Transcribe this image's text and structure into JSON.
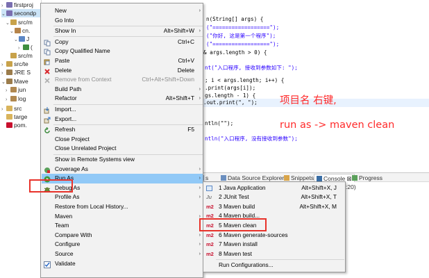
{
  "tree": {
    "items": [
      {
        "label": "firstproj",
        "indent": 0,
        "arrow": "›",
        "icon_color": "#7a6fb0"
      },
      {
        "label": "secondp",
        "indent": 0,
        "arrow": "⌄",
        "icon_color": "#7a6fb0",
        "selected": true
      },
      {
        "label": "src/m",
        "indent": 1,
        "arrow": "⌄",
        "icon_color": "#c8a24a"
      },
      {
        "label": "cn.",
        "indent": 2,
        "arrow": "⌄",
        "icon_color": "#b6844a"
      },
      {
        "label": "J",
        "indent": 3,
        "arrow": "⌄",
        "icon_color": "#5b87c5"
      },
      {
        "label": "(",
        "indent": 4,
        "arrow": "›",
        "icon_color": "#3f8f3f"
      },
      {
        "label": "src/m",
        "indent": 1,
        "arrow": "",
        "icon_color": "#c8a24a"
      },
      {
        "label": "src/te",
        "indent": 0,
        "arrow": "›",
        "icon_color": "#c8a24a"
      },
      {
        "label": "JRE S",
        "indent": 0,
        "arrow": "›",
        "icon_color": "#9b7c4b"
      },
      {
        "label": "Mave",
        "indent": 0,
        "arrow": "⌄",
        "icon_color": "#9b7c4b"
      },
      {
        "label": "jun",
        "indent": 1,
        "arrow": "›",
        "icon_color": "#b08850"
      },
      {
        "label": "log",
        "indent": 1,
        "arrow": "›",
        "icon_color": "#b08850"
      },
      {
        "label": "src",
        "indent": 0,
        "arrow": "›",
        "icon_color": "#d9b45c"
      },
      {
        "label": "targe",
        "indent": 0,
        "arrow": "",
        "icon_color": "#d9b45c"
      },
      {
        "label": "pom.",
        "indent": 0,
        "arrow": "",
        "icon_color": "#c8102e"
      }
    ]
  },
  "editor": {
    "lines": [
      {
        "parts": [
          {
            "t": "n(String[] args) {",
            "c": ""
          }
        ]
      },
      {
        "parts": [
          {
            "t": "(\"==================\");",
            "c": "str"
          }
        ]
      },
      {
        "parts": [
          {
            "t": "(\"你好, 这是第一个程序\");",
            "c": "str"
          }
        ]
      },
      {
        "parts": [
          {
            "t": "(\"==================\");",
            "c": "str"
          }
        ]
      },
      {
        "parts": [
          {
            "t": "",
            "c": ""
          }
        ]
      },
      {
        "parts": [
          {
            "t": "& args.length > 0) {",
            "c": ""
          }
        ]
      },
      {
        "parts": [
          {
            "t": "",
            "c": ""
          }
        ]
      },
      {
        "parts": [
          {
            "t": "nt(\"入口程序, 接收到参数如下: \");",
            "c": "str"
          }
        ]
      },
      {
        "parts": [
          {
            "t": "",
            "c": ""
          }
        ]
      },
      {
        "parts": [
          {
            "t": "; i < args.length; i++) {",
            "c": ""
          }
        ]
      },
      {
        "parts": [
          {
            "t": ".print(args[i]);",
            "c": ""
          }
        ]
      },
      {
        "parts": [
          {
            "t": "gs.length - 1) {",
            "c": ""
          }
        ]
      },
      {
        "parts": [
          {
            "t": ".out.print(\", \");",
            "c": ""
          }
        ]
      },
      {
        "parts": [
          {
            "t": "",
            "c": ""
          }
        ]
      },
      {
        "parts": [
          {
            "t": "ntln(\"\");",
            "c": ""
          }
        ]
      },
      {
        "parts": [
          {
            "t": "ntln(\"入口程序, 没有接收到参数\");",
            "c": "str"
          }
        ]
      }
    ],
    "annotation_1": "项目名 右键,",
    "annotation_2": "run as -> maven clean"
  },
  "bottom_tabs": [
    {
      "label": "s",
      "icon": "tab-icon"
    },
    {
      "label": "Data Source Explorer",
      "icon": "data-source-icon"
    },
    {
      "label": "Snippets",
      "icon": "snippets-icon"
    },
    {
      "label": "Console ⊠",
      "icon": "console-icon",
      "active": true
    },
    {
      "label": "Progress",
      "icon": "progress-icon"
    }
  ],
  "console_cut_text": ":20)",
  "menu": {
    "items": [
      {
        "label": "New",
        "accel": "",
        "submenu": true,
        "icon": ""
      },
      {
        "label": "Go Into",
        "accel": "",
        "submenu": false,
        "icon": ""
      },
      {
        "sep": true
      },
      {
        "label": "Show In",
        "accel": "Alt+Shift+W",
        "submenu": true,
        "icon": ""
      },
      {
        "sep": true
      },
      {
        "label": "Copy",
        "accel": "Ctrl+C",
        "submenu": false,
        "icon": "copy-icon"
      },
      {
        "label": "Copy Qualified Name",
        "accel": "",
        "submenu": false,
        "icon": "copy-icon"
      },
      {
        "label": "Paste",
        "accel": "Ctrl+V",
        "submenu": false,
        "icon": "paste-icon"
      },
      {
        "label": "Delete",
        "accel": "Delete",
        "submenu": false,
        "icon": "delete-icon"
      },
      {
        "label": "Remove from Context",
        "accel": "Ctrl+Alt+Shift+Down",
        "submenu": false,
        "icon": "remove-icon",
        "disabled": true
      },
      {
        "label": "Build Path",
        "accel": "",
        "submenu": true,
        "icon": ""
      },
      {
        "label": "Refactor",
        "accel": "Alt+Shift+T",
        "submenu": true,
        "icon": ""
      },
      {
        "sep": true
      },
      {
        "label": "Import...",
        "accel": "",
        "submenu": false,
        "icon": "import-icon"
      },
      {
        "label": "Export...",
        "accel": "",
        "submenu": false,
        "icon": "export-icon"
      },
      {
        "sep": true
      },
      {
        "label": "Refresh",
        "accel": "F5",
        "submenu": false,
        "icon": "refresh-icon"
      },
      {
        "label": "Close Project",
        "accel": "",
        "submenu": false,
        "icon": ""
      },
      {
        "label": "Close Unrelated Project",
        "accel": "",
        "submenu": false,
        "icon": ""
      },
      {
        "sep": true
      },
      {
        "label": "Show in Remote Systems view",
        "accel": "",
        "submenu": false,
        "icon": ""
      },
      {
        "label": "Coverage As",
        "accel": "",
        "submenu": true,
        "icon": "coverage-icon"
      },
      {
        "label": "Run As",
        "accel": "",
        "submenu": true,
        "icon": "run-icon",
        "hover": true
      },
      {
        "label": "Debug As",
        "accel": "",
        "submenu": true,
        "icon": "debug-icon"
      },
      {
        "label": "Profile As",
        "accel": "",
        "submenu": true,
        "icon": ""
      },
      {
        "label": "Restore from Local History...",
        "accel": "",
        "submenu": false,
        "icon": ""
      },
      {
        "label": "Maven",
        "accel": "",
        "submenu": true,
        "icon": ""
      },
      {
        "label": "Team",
        "accel": "",
        "submenu": true,
        "icon": ""
      },
      {
        "label": "Compare With",
        "accel": "",
        "submenu": true,
        "icon": ""
      },
      {
        "label": "Configure",
        "accel": "",
        "submenu": true,
        "icon": ""
      },
      {
        "label": "Source",
        "accel": "",
        "submenu": true,
        "icon": ""
      },
      {
        "label": "Validate",
        "accel": "",
        "submenu": false,
        "icon": "validate-icon"
      }
    ]
  },
  "submenu": {
    "items": [
      {
        "label": "1 Java Application",
        "accel": "Alt+Shift+X, J",
        "icon": "java-app-icon"
      },
      {
        "label": "2 JUnit Test",
        "accel": "Alt+Shift+X, T",
        "icon": "junit-icon"
      },
      {
        "label": "3 Maven build",
        "accel": "Alt+Shift+X, M",
        "icon": "maven-m2-icon"
      },
      {
        "label": "4 Maven build...",
        "accel": "",
        "icon": "maven-m2-icon"
      },
      {
        "label": "5 Maven clean",
        "accel": "",
        "icon": "maven-m2-icon",
        "boxed": true
      },
      {
        "label": "6 Maven generate-sources",
        "accel": "",
        "icon": "maven-m2-icon"
      },
      {
        "label": "7 Maven install",
        "accel": "",
        "icon": "maven-m2-icon"
      },
      {
        "label": "8 Maven test",
        "accel": "",
        "icon": "maven-m2-icon"
      },
      {
        "sep": true
      },
      {
        "label": "Run Configurations...",
        "accel": "",
        "icon": ""
      }
    ]
  },
  "glyphs": {
    "submenu_arrow": "›",
    "m2": "m2",
    "ju": "Ju"
  },
  "colors": {
    "accent_red": "#e8322a",
    "hover_blue": "#91c9f7",
    "maven_red": "#c8102e"
  }
}
